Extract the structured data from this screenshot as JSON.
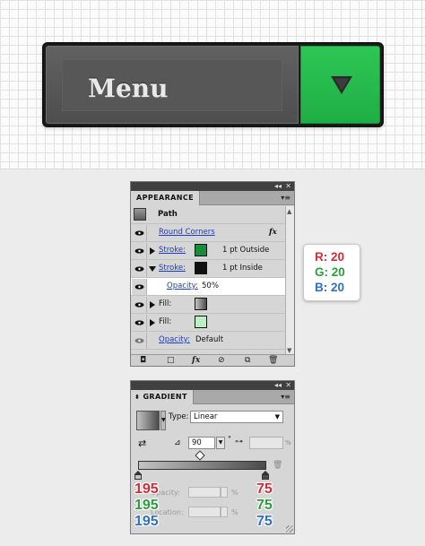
{
  "preview": {
    "menu_label": "Menu",
    "colors": {
      "button_green": "#2ec655",
      "button_dark": "#555555",
      "arrow": "#3e3e3e"
    },
    "arrow_icon": "triangle-down-icon"
  },
  "appearance_panel": {
    "tab_label": "APPEARANCE",
    "header_controls": "◂◂ ✕",
    "menu_icon": "panel-menu-icon",
    "object_label": "Path",
    "rows": [
      {
        "label": "Round Corners",
        "fx": "fx"
      },
      {
        "label": "Stroke:",
        "swatch_color": "#1a8a3c",
        "value": "1 pt  Outside"
      },
      {
        "label": "Stroke:",
        "swatch_color": "#111111",
        "value": "1 pt  Inside"
      },
      {
        "label": "Opacity:",
        "value": "50%"
      },
      {
        "label": "Fill:",
        "swatch_color": "gradient-gray"
      },
      {
        "label": "Fill:",
        "swatch_color": "#b6f0c4"
      },
      {
        "label": "Opacity:",
        "value": "Default"
      }
    ],
    "bottom_icons": [
      "stroke-fill-icon",
      "new-fill-icon",
      "fx-icon",
      "clear-icon",
      "duplicate-icon",
      "trash-icon"
    ]
  },
  "gradient_panel": {
    "tab_label": "GRADIENT",
    "header_controls": "◂◂ ✕",
    "type_label": "Type:",
    "type_value": "Linear",
    "angle_value": "90",
    "degree_symbol": "°",
    "percent_symbol": "%",
    "opacity_label": "Opacity:",
    "location_label": "Location:",
    "stop_left_color": "#c3c3c3",
    "stop_right_color": "#4b4b4b",
    "left_stop_rgb": {
      "r": "195",
      "g": "195",
      "b": "195"
    },
    "right_stop_rgb": {
      "r": "75",
      "g": "75",
      "b": "75"
    }
  },
  "rgb_callout": {
    "r_line": "R: 20",
    "g_line": "G: 20",
    "b_line": "B: 20",
    "colors": {
      "r": "#d62b35",
      "g": "#2a9d3c",
      "b": "#2f6fc4"
    }
  }
}
